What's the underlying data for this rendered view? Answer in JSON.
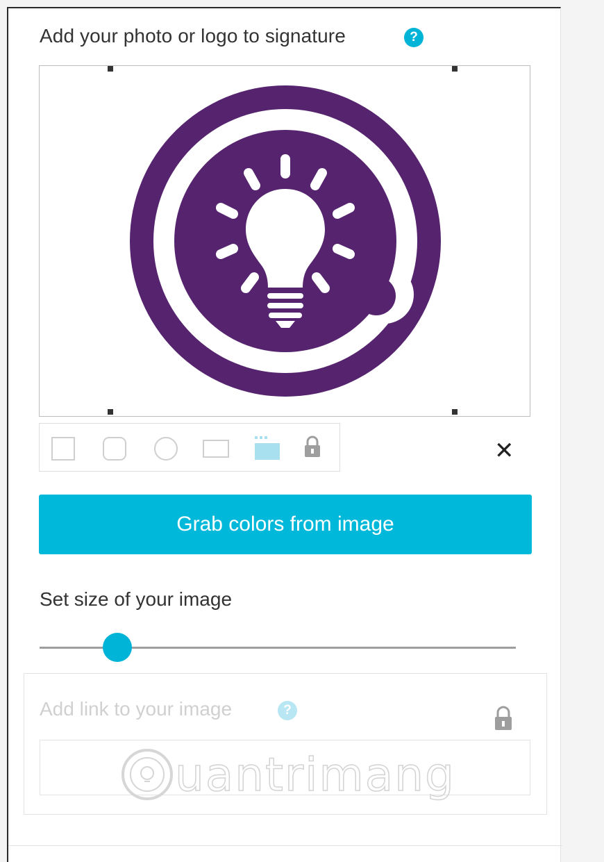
{
  "photo_section": {
    "title": "Add your photo or logo to signature",
    "help_icon": "?"
  },
  "image_editor": {
    "logo": "lightbulb-q-logo",
    "logo_color": "#56246f",
    "shape_options": [
      "square-shape-icon",
      "rounded-square-shape-icon",
      "circle-shape-icon",
      "rectangle-shape-icon",
      "original-image-icon",
      "lock-icon"
    ],
    "close_label": "✕"
  },
  "grab_button": {
    "label": "Grab colors from image",
    "color": "#00b8d9"
  },
  "size_section": {
    "title": "Set size of your image",
    "slider_fraction": 0.16
  },
  "link_section": {
    "title": "Add link to your image",
    "help_icon": "?",
    "input_value": ""
  },
  "watermark": {
    "text": "uantrimang"
  }
}
